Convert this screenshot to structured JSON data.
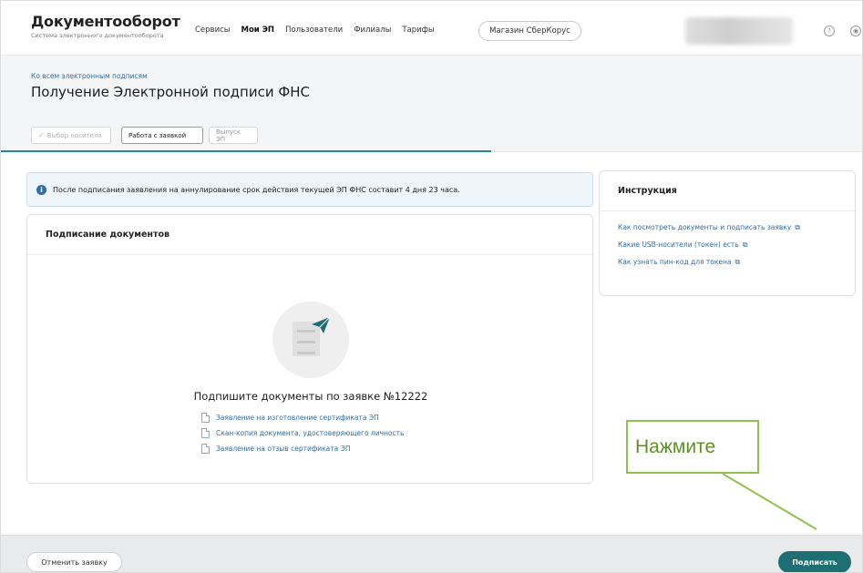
{
  "header": {
    "brand_title": "Документооборот",
    "brand_subtitle": "Система электронного документооборота",
    "nav": [
      "Сервисы",
      "Мои ЭП",
      "Пользователи",
      "Филиалы",
      "Тарифы"
    ],
    "shop_button": "Магазин СберКорус",
    "help_icon": "question-circle-icon",
    "eye_icon": "eye-icon"
  },
  "title_area": {
    "back_link": "Ко всем электронным подписям",
    "page_title": "Получение Электронной подписи ФНС"
  },
  "stepper": {
    "steps": [
      "Выбор носителя",
      "Работа с заявкой",
      "Выпуск ЭП"
    ],
    "active_index": 1
  },
  "info_banner": {
    "text": "После подписания заявления на аннулирование срок действия текущей ЭП ФНС составит 4 дня 23 часа."
  },
  "docs_card": {
    "title": "Подписание документов",
    "sign_title": "Подпишите документы по заявке №12222",
    "documents": [
      "Заявление на изготовление сертификата ЭП",
      "Скан-копия документа, удостоверяющего личность",
      "Заявление на отзыв сертификата ЭП"
    ]
  },
  "instructions": {
    "title": "Инструкция",
    "links": [
      "Как посмотреть документы и подписать заявку",
      "Какие USB-носители (токен) есть",
      "Как узнать пин-код для токена"
    ]
  },
  "footer": {
    "cancel_button": "Отменить заявку",
    "sign_button": "Подписать"
  },
  "annotation": {
    "callout_text": "Нажмите",
    "color": "#8ec34b"
  },
  "colors": {
    "accent": "#1e6f74",
    "link": "#2e6fa8",
    "progress": "#238a8c"
  }
}
